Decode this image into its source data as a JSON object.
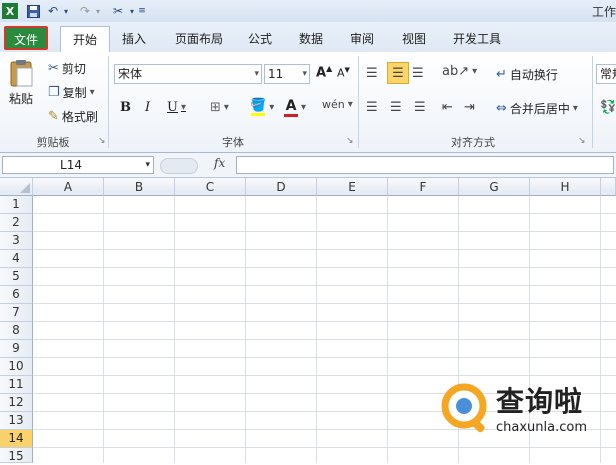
{
  "window": {
    "title": "工作"
  },
  "tabs": {
    "file": "文件",
    "home": "开始",
    "insert": "插入",
    "page_layout": "页面布局",
    "formulas": "公式",
    "data": "数据",
    "review": "审阅",
    "view": "视图",
    "developer": "开发工具"
  },
  "clipboard": {
    "paste": "粘贴",
    "cut": "剪切",
    "copy": "复制",
    "format_painter": "格式刷",
    "group_label": "剪贴板"
  },
  "font": {
    "name": "宋体",
    "size": "11",
    "bold": "B",
    "italic": "I",
    "underline": "U",
    "group_label": "字体",
    "font_color": "#d02020",
    "fill_color": "#ffff00"
  },
  "alignment": {
    "wrap_text": "自动换行",
    "merge_center": "合并后居中",
    "group_label": "对齐方式"
  },
  "number": {
    "format": "常规"
  },
  "formula_bar": {
    "name_box": "L14",
    "fx": "fx",
    "value": ""
  },
  "grid": {
    "columns": [
      "A",
      "B",
      "C",
      "D",
      "E",
      "F",
      "G",
      "H"
    ],
    "rows": [
      "1",
      "2",
      "3",
      "4",
      "5",
      "6",
      "7",
      "8",
      "9",
      "10",
      "11",
      "12",
      "13",
      "14",
      "15"
    ],
    "active_row": "14",
    "active_color": "#f9d26a"
  },
  "watermark": {
    "brand": "查询啦",
    "url": "chaxunla.com",
    "brand_color": "#f5a623"
  }
}
